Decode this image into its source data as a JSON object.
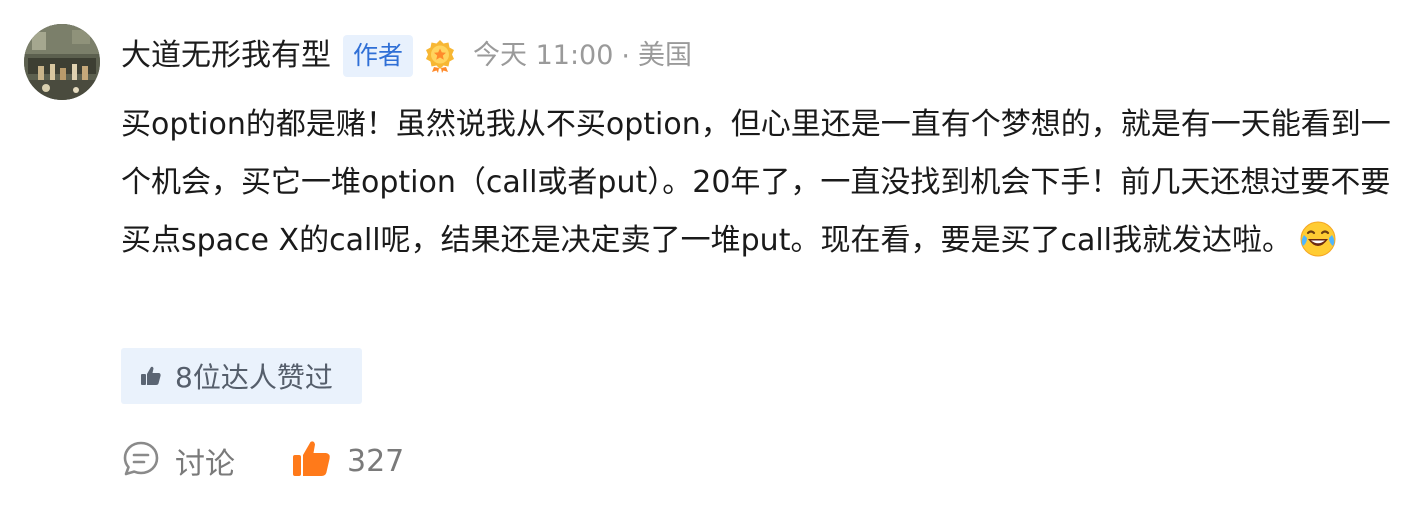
{
  "comment": {
    "author": {
      "name": "大道无形我有型",
      "badge_label": "作者",
      "medal_icon": "gold-star-medal-icon"
    },
    "meta": {
      "time": "今天 11:00",
      "separator": "·",
      "location": "美国"
    },
    "body": "买option的都是赌！虽然说我从不买option，但心里还是一直有个梦想的，就是有一天能看到一个机会，买它一堆option（call或者put）。20年了，一直没找到机会下手！前几天还想过要不要买点space X的call呢，结果还是决定卖了一堆put。现在看，要是买了call我就发达啦。",
    "body_emoji": "laughing-tears-emoji-icon",
    "likers": {
      "label": "8位达人赞过",
      "icon": "thumbs-up-icon"
    },
    "actions": {
      "discuss_label": "讨论",
      "like_count": "327"
    }
  },
  "colors": {
    "badge_bg": "#e8f1fd",
    "badge_text": "#2f6fd6",
    "like_orange": "#ff7a1a",
    "meta_gray": "#9a9a9a",
    "likers_bg": "#eaf2fc"
  }
}
